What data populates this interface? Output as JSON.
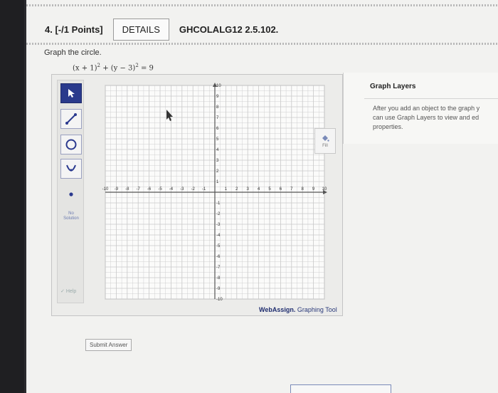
{
  "question": {
    "number": "4.",
    "points": "[-/1 Points]",
    "details_label": "DETAILS",
    "code": "GHCOLALG12 2.5.102."
  },
  "prompt": "Graph the circle.",
  "equation": {
    "part1": "(x + 1)",
    "exp1": "2",
    "part2": " + (y − 3)",
    "exp2": "2",
    "part3": " = 9"
  },
  "tools": {
    "no_solution": "No Solution",
    "help": "Help"
  },
  "graph": {
    "x_min": -10,
    "x_max": 10,
    "y_min": -10,
    "y_max": 10,
    "x_ticks": [
      "-10",
      "-9",
      "-8",
      "-7",
      "-6",
      "-5",
      "-4",
      "-3",
      "-2",
      "-1",
      "1",
      "2",
      "3",
      "4",
      "5",
      "6",
      "7",
      "8",
      "9",
      "10"
    ],
    "y_ticks": [
      "10",
      "9",
      "8",
      "7",
      "6",
      "5",
      "4",
      "3",
      "2",
      "1",
      "-1",
      "-2",
      "-3",
      "-4",
      "-5",
      "-6",
      "-7",
      "-8",
      "-9",
      "-10"
    ]
  },
  "fill_label": "Fill",
  "brand": {
    "name": "WebAssign.",
    "suffix": " Graphing Tool"
  },
  "layers": {
    "title": "Graph Layers",
    "line1": "After you add an object to the graph y",
    "line2": "can use Graph Layers to view and ed",
    "line3": "properties."
  },
  "submit_label": "Submit Answer",
  "colors": {
    "accent": "#2a3a8c",
    "grid": "#c8c8c8",
    "axis": "#555555"
  }
}
